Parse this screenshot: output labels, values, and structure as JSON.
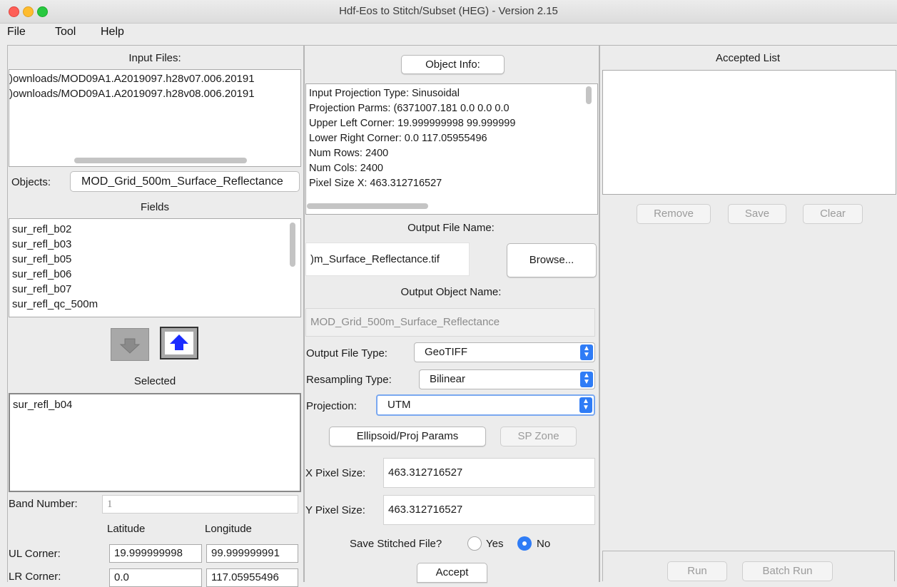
{
  "window": {
    "title": "Hdf-Eos to Stitch/Subset (HEG) - Version 2.15"
  },
  "menu": [
    "File",
    "Tool",
    "Help"
  ],
  "left": {
    "input_files_label": "Input Files:",
    "input_files": [
      ")ownloads/MOD09A1.A2019097.h28v07.006.20191",
      ")ownloads/MOD09A1.A2019097.h28v08.006.20191"
    ],
    "objects_label": "Objects:",
    "objects_value": "MOD_Grid_500m_Surface_Reflectance",
    "fields_label": "Fields",
    "fields": [
      "sur_refl_b02",
      "sur_refl_b03",
      "sur_refl_b05",
      "sur_refl_b06",
      "sur_refl_b07",
      "sur_refl_qc_500m"
    ],
    "selected_label": "Selected",
    "selected": [
      "sur_refl_b04"
    ],
    "band_number_label": "Band Number:",
    "band_number_value": "1",
    "latitude_label": "Latitude",
    "longitude_label": "Longitude",
    "ul_corner_label": "UL Corner:",
    "ul_lat": "19.999999998",
    "ul_lon": "99.999999991",
    "lr_corner_label": "LR Corner:",
    "lr_lat": "0.0",
    "lr_lon": "117.05955496"
  },
  "middle": {
    "object_info_button": "Object Info:",
    "info_lines": [
      "Input Projection Type:  Sinusoidal",
      "Projection Parms:  (6371007.181   0.0   0.0   0.0",
      "Upper Left Corner:  19.999999998     99.999999",
      "Lower Right Corner:  0.0     117.05955496",
      "Num Rows:  2400",
      "Num Cols:  2400",
      "Pixel Size X:  463.312716527"
    ],
    "output_file_name_label": "Output File Name:",
    "output_file_name": ")m_Surface_Reflectance.tif",
    "browse_button": "Browse...",
    "output_object_name_label": "Output Object Name:",
    "output_object_name": "MOD_Grid_500m_Surface_Reflectance",
    "output_file_type_label": "Output File Type:",
    "output_file_type": "GeoTIFF",
    "resampling_type_label": "Resampling Type:",
    "resampling_type": "Bilinear",
    "projection_label": "Projection:",
    "projection": "UTM",
    "ellipsoid_button": "Ellipsoid/Proj Params",
    "sp_zone_button": "SP Zone",
    "x_pixel_label": "X Pixel Size:",
    "x_pixel_value": "463.312716527",
    "y_pixel_label": "Y Pixel Size:",
    "y_pixel_value": "463.312716527",
    "save_stitched_label": "Save Stitched File?",
    "yes_label": "Yes",
    "no_label": "No",
    "save_stitched_selected": "No",
    "accept_button": "Accept"
  },
  "right": {
    "accepted_list_label": "Accepted List",
    "remove_button": "Remove",
    "save_button": "Save",
    "clear_button": "Clear",
    "run_button": "Run",
    "batch_run_button": "Batch Run"
  },
  "colors": {
    "accent": "#2f7cf6",
    "close": "#fe5f57",
    "minimize": "#febc2e",
    "zoom": "#28c840"
  }
}
